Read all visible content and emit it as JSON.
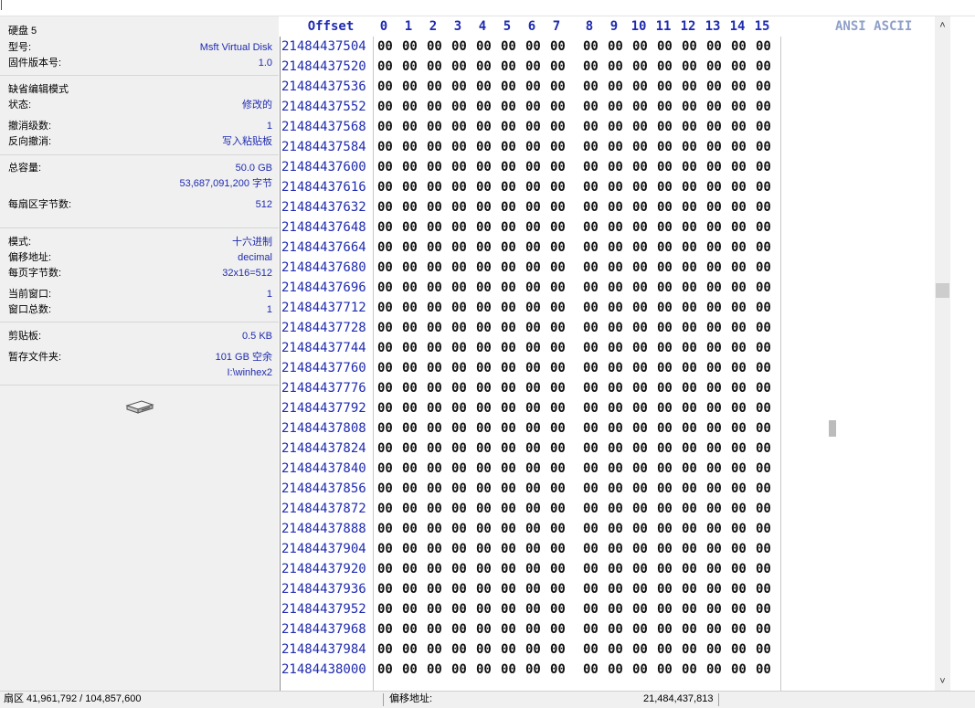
{
  "info_panel": {
    "disk_title": "硬盘 5",
    "rows": [
      {
        "label": "型号:",
        "value": "Msft Virtual Disk"
      },
      {
        "label": "固件版本号:",
        "value": "1.0"
      },
      {
        "label": "缺省编辑模式",
        "value": ""
      },
      {
        "label": "状态:",
        "value": "修改的"
      },
      {
        "label": "撤消级数:",
        "value": "1"
      },
      {
        "label": "反向撤消:",
        "value": "写入粘贴板"
      },
      {
        "label": "总容量:",
        "value": "50.0 GB"
      },
      {
        "label": "",
        "value": "53,687,091,200 字节"
      },
      {
        "label": "每扇区字节数:",
        "value": "512"
      },
      {
        "label": "模式:",
        "value": "十六进制"
      },
      {
        "label": "偏移地址:",
        "value": "decimal"
      },
      {
        "label": "每页字节数:",
        "value": "32x16=512"
      },
      {
        "label": "当前窗口:",
        "value": "1"
      },
      {
        "label": "窗口总数:",
        "value": "1"
      },
      {
        "label": "剪贴板:",
        "value": "0.5 KB"
      },
      {
        "label": "暂存文件夹:",
        "value": "101 GB 空余"
      },
      {
        "label": "",
        "value": "I:\\winhex2"
      }
    ],
    "disk_icon": "hard-disk-icon"
  },
  "hex_view": {
    "offset_header": "Offset",
    "column_headers": [
      "0",
      "1",
      "2",
      "3",
      "4",
      "5",
      "6",
      "7",
      "8",
      "9",
      "10",
      "11",
      "12",
      "13",
      "14",
      "15"
    ],
    "ascii_header": "ANSI ASCII",
    "offsets": [
      "21484437504",
      "21484437520",
      "21484437536",
      "21484437552",
      "21484437568",
      "21484437584",
      "21484437600",
      "21484437616",
      "21484437632",
      "21484437648",
      "21484437664",
      "21484437680",
      "21484437696",
      "21484437712",
      "21484437728",
      "21484437744",
      "21484437760",
      "21484437776",
      "21484437792",
      "21484437808",
      "21484437824",
      "21484437840",
      "21484437856",
      "21484437872",
      "21484437888",
      "21484437904",
      "21484437920",
      "21484437936",
      "21484437952",
      "21484437968",
      "21484437984",
      "21484438000"
    ],
    "byte_value": "00"
  },
  "status_bar": {
    "sector": "扇区 41,961,792 / 104,857,600",
    "offset_label": "偏移地址:",
    "offset_value": "21,484,437,813"
  },
  "scrollbar": {
    "up_icon": "chevron-up-icon",
    "down_icon": "chevron-down-icon"
  }
}
